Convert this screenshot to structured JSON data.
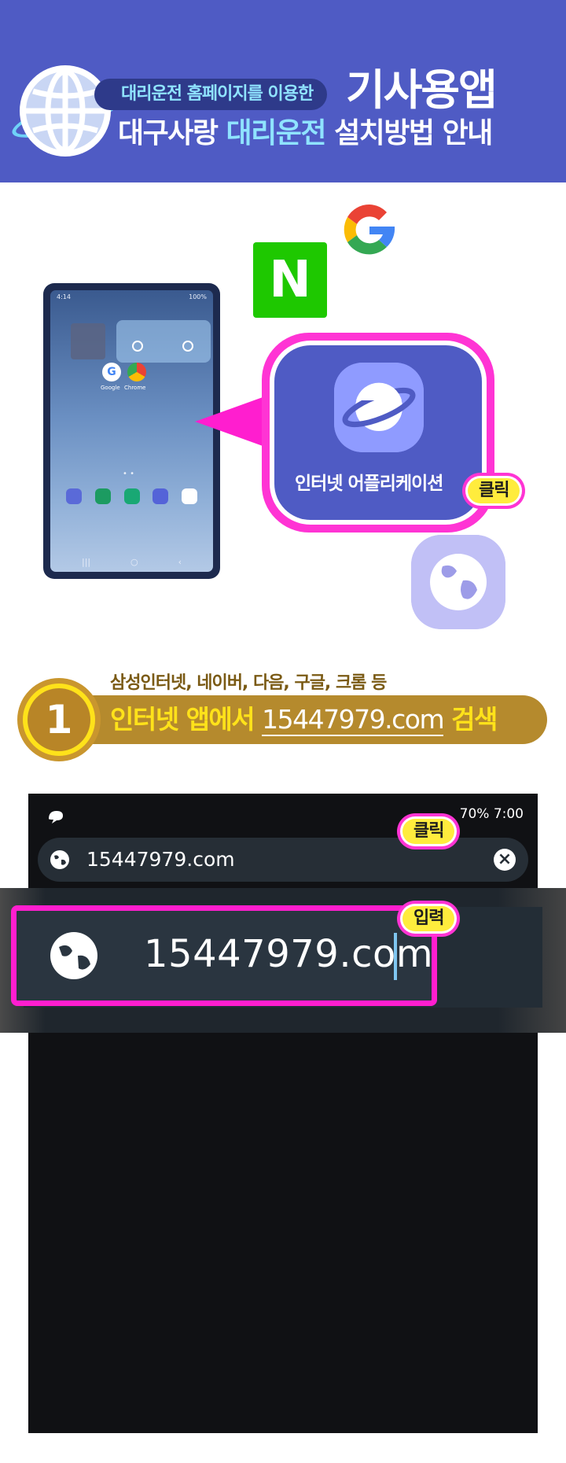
{
  "header": {
    "subtitle": "대리운전 홈페이지를 이용한",
    "title": "기사용앱",
    "line2_part1": "대구사랑",
    "line2_part2": "대리운전",
    "line2_part3": "설치방법 안내",
    "bg_color": "#4f5bc4",
    "accent_color": "#8fe3ff"
  },
  "illustration": {
    "naver_letter": "N",
    "google_icon": "google-g-icon",
    "tablet": {
      "time": "4:14",
      "battery": "100%",
      "apps": [
        "Google",
        "Chrome"
      ]
    },
    "app_label": "인터넷 어플리케이션",
    "click_badge": "클릭",
    "highlight_color": "#ff34d4"
  },
  "step1": {
    "number": "1",
    "subtitle": "삼성인터넷, 네이버, 다음, 구글, 크롬 등",
    "text_prefix": "인터넷 앱에서",
    "url": "15447979.com",
    "text_suffix": "검색",
    "bar_color": "#b58a2d",
    "text_color": "#ffe21a"
  },
  "phone": {
    "status_right": "70%  7:00",
    "url_value": "15447979.com",
    "click_badge": "클릭",
    "zoom_url": "15447979.com",
    "input_badge": "입력"
  }
}
